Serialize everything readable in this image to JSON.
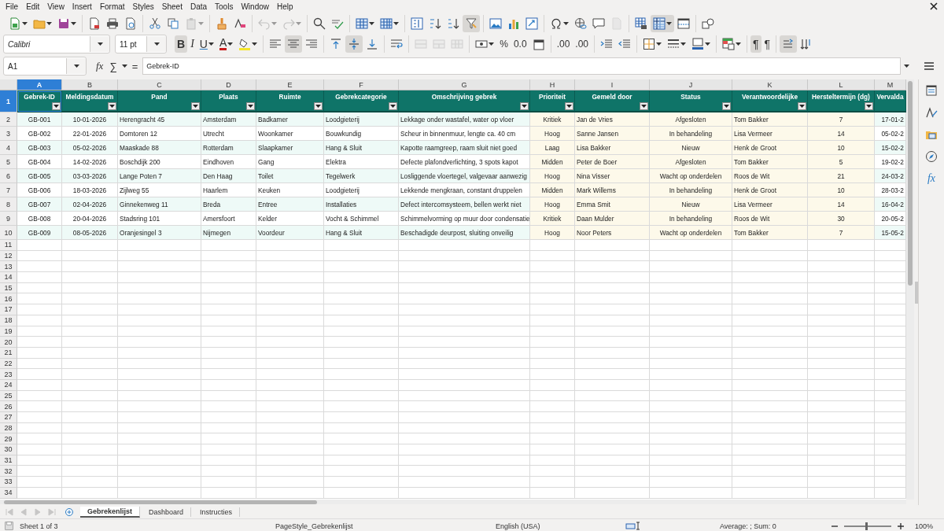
{
  "menu_bar": [
    "File",
    "Edit",
    "View",
    "Insert",
    "Format",
    "Styles",
    "Sheet",
    "Data",
    "Tools",
    "Window",
    "Help"
  ],
  "standard_toolbar": [
    [
      {
        "kind": "newsheet",
        "active": false,
        "disabled": false
      },
      {
        "kind": "open",
        "active": false,
        "disabled": false
      },
      {
        "kind": "save",
        "active": false,
        "disabled": false
      }
    ],
    [
      {
        "kind": "exportpdf",
        "active": false,
        "disabled": false
      },
      {
        "kind": "print",
        "active": false,
        "disabled": false
      },
      {
        "kind": "preview",
        "active": false,
        "disabled": false
      }
    ],
    [
      {
        "kind": "cut",
        "active": false,
        "disabled": false
      },
      {
        "kind": "copy",
        "active": false,
        "disabled": false
      },
      {
        "kind": "paste",
        "active": false,
        "disabled": true
      }
    ],
    [
      {
        "kind": "clone",
        "active": false,
        "disabled": false
      },
      {
        "kind": "clear",
        "active": false,
        "disabled": false
      }
    ],
    [
      {
        "kind": "undo",
        "active": false,
        "disabled": true
      },
      {
        "kind": "redo",
        "active": false,
        "disabled": true
      }
    ],
    [
      {
        "kind": "find",
        "active": false,
        "disabled": false
      },
      {
        "kind": "spelling",
        "active": false,
        "disabled": false
      }
    ],
    [
      {
        "kind": "row",
        "active": false,
        "disabled": false
      },
      {
        "kind": "column",
        "active": false,
        "disabled": false
      }
    ],
    [
      {
        "kind": "sort",
        "active": false,
        "disabled": false
      },
      {
        "kind": "sortasc",
        "active": false,
        "disabled": false
      },
      {
        "kind": "sortdesc",
        "active": false,
        "disabled": false
      },
      {
        "kind": "autofilter",
        "active": true,
        "disabled": false
      }
    ],
    [
      {
        "kind": "image",
        "active": false,
        "disabled": false
      },
      {
        "kind": "chart",
        "active": false,
        "disabled": false
      },
      {
        "kind": "pivot",
        "active": false,
        "disabled": false
      }
    ],
    [
      {
        "kind": "specialchar",
        "active": false,
        "disabled": false
      },
      {
        "kind": "hyperlink",
        "active": false,
        "disabled": false
      },
      {
        "kind": "comment",
        "active": false,
        "disabled": false
      },
      {
        "kind": "headerfooter",
        "active": false,
        "disabled": true
      }
    ],
    [
      {
        "kind": "printarea",
        "active": false,
        "disabled": false
      },
      {
        "kind": "freeze",
        "active": true,
        "disabled": false
      },
      {
        "kind": "split",
        "active": false,
        "disabled": false
      }
    ],
    [
      {
        "kind": "shapes",
        "active": false,
        "disabled": false
      }
    ]
  ],
  "font_name": "Calibri",
  "font_size": "11 pt",
  "formatting_toolbar": [
    [
      {
        "kind": "bold",
        "label": "B",
        "active": true,
        "disabled": false
      },
      {
        "kind": "italic",
        "label": "I",
        "active": false,
        "disabled": false
      },
      {
        "kind": "underline",
        "label": "U",
        "active": false,
        "disabled": false
      },
      {
        "kind": "fontcolor",
        "label": "A",
        "active": false,
        "disabled": false
      },
      {
        "kind": "highlight",
        "active": false,
        "disabled": false
      }
    ],
    [
      {
        "kind": "alignleft",
        "active": false,
        "disabled": false
      },
      {
        "kind": "aligncenter",
        "active": true,
        "disabled": false
      },
      {
        "kind": "alignright",
        "active": false,
        "disabled": false
      }
    ],
    [
      {
        "kind": "aligntop",
        "active": false,
        "disabled": false
      },
      {
        "kind": "alignmiddle",
        "active": true,
        "disabled": false
      },
      {
        "kind": "alignbottom",
        "active": false,
        "disabled": false
      }
    ],
    [
      {
        "kind": "wraptext",
        "active": false,
        "disabled": false
      }
    ],
    [
      {
        "kind": "merge",
        "active": false,
        "disabled": true
      },
      {
        "kind": "mergecells",
        "active": false,
        "disabled": true
      },
      {
        "kind": "unmerge",
        "active": false,
        "disabled": true
      }
    ],
    [
      {
        "kind": "currency",
        "active": false,
        "disabled": false
      },
      {
        "kind": "percent",
        "label": "%",
        "active": false,
        "disabled": false
      },
      {
        "kind": "number",
        "label": "0.0",
        "active": false,
        "disabled": false
      },
      {
        "kind": "date",
        "active": false,
        "disabled": false
      }
    ],
    [
      {
        "kind": "adddecimal",
        "label": ".00",
        "active": false,
        "disabled": false
      },
      {
        "kind": "deletedecimal",
        "label": ".00",
        "active": false,
        "disabled": false
      }
    ],
    [
      {
        "kind": "indent",
        "active": false,
        "disabled": false
      },
      {
        "kind": "outdent",
        "active": false,
        "disabled": false
      }
    ],
    [
      {
        "kind": "borders",
        "active": false,
        "disabled": false
      },
      {
        "kind": "borderstyle",
        "active": false,
        "disabled": false
      },
      {
        "kind": "bordercolor",
        "active": false,
        "disabled": false
      }
    ],
    [
      {
        "kind": "conditional",
        "active": false,
        "disabled": false
      }
    ],
    [
      {
        "kind": "ltr",
        "label": "¶",
        "active": true,
        "disabled": false
      },
      {
        "kind": "rtl",
        "label": "¶",
        "active": false,
        "disabled": false
      }
    ],
    [
      {
        "kind": "textdirection",
        "active": true,
        "disabled": false
      },
      {
        "kind": "stacked",
        "active": false,
        "disabled": false
      }
    ]
  ],
  "name_box": "A1",
  "function_wizard": "fx",
  "sum": "∑",
  "equals": "=",
  "formula": "Gebrek-ID",
  "column_headers": [
    {
      "label": "A",
      "selected": true
    },
    {
      "label": "B",
      "selected": false
    },
    {
      "label": "C",
      "selected": false
    },
    {
      "label": "D",
      "selected": false
    },
    {
      "label": "E",
      "selected": false
    },
    {
      "label": "F",
      "selected": false
    },
    {
      "label": "G",
      "selected": false
    },
    {
      "label": "H",
      "selected": false
    },
    {
      "label": "I",
      "selected": false
    },
    {
      "label": "J",
      "selected": false
    },
    {
      "label": "K",
      "selected": false
    },
    {
      "label": "L",
      "selected": false
    },
    {
      "label": "M",
      "selected": false
    }
  ],
  "header_row": {
    "number": "1",
    "selected": true,
    "cells": [
      "Gebrek-ID",
      "Meldingsdatum",
      "Pand",
      "Plaats",
      "Ruimte",
      "Gebrekcategorie",
      "Omschrijving gebrek",
      "Prioriteit",
      "Gemeld door",
      "Status",
      "Verantwoordelijke",
      "Hersteltermijn (dg)",
      "Vervalda"
    ]
  },
  "rows": [
    {
      "number": "2",
      "selected": false,
      "cells": [
        "GB-001",
        "10-01-2026",
        "Herengracht 45",
        "Amsterdam",
        "Badkamer",
        "Loodgieterij",
        "Lekkage onder wastafel, water op vloer",
        "Kritiek",
        "Jan de Vries",
        "Afgesloten",
        "Tom Bakker",
        "7",
        "17-01-2"
      ]
    },
    {
      "number": "3",
      "selected": false,
      "cells": [
        "GB-002",
        "22-01-2026",
        "Domtoren 12",
        "Utrecht",
        "Woonkamer",
        "Bouwkundig",
        "Scheur in binnenmuur, lengte ca. 40 cm",
        "Hoog",
        "Sanne Jansen",
        "In behandeling",
        "Lisa Vermeer",
        "14",
        "05-02-2"
      ]
    },
    {
      "number": "4",
      "selected": false,
      "cells": [
        "GB-003",
        "05-02-2026",
        "Maaskade 88",
        "Rotterdam",
        "Slaapkamer",
        "Hang & Sluit",
        "Kapotte raamgreep, raam sluit niet goed",
        "Laag",
        "Lisa Bakker",
        "Nieuw",
        "Henk de Groot",
        "10",
        "15-02-2"
      ]
    },
    {
      "number": "5",
      "selected": false,
      "cells": [
        "GB-004",
        "14-02-2026",
        "Boschdijk 200",
        "Eindhoven",
        "Gang",
        "Elektra",
        "Defecte plafondverlichting, 3 spots kapot",
        "Midden",
        "Peter de Boer",
        "Afgesloten",
        "Tom Bakker",
        "5",
        "19-02-2"
      ]
    },
    {
      "number": "6",
      "selected": false,
      "cells": [
        "GB-005",
        "03-03-2026",
        "Lange Poten 7",
        "Den Haag",
        "Toilet",
        "Tegelwerk",
        "Losliggende vloertegel, valgevaar aanwezig",
        "Hoog",
        "Nina Visser",
        "Wacht op onderdelen",
        "Roos de Wit",
        "21",
        "24-03-2"
      ]
    },
    {
      "number": "7",
      "selected": false,
      "cells": [
        "GB-006",
        "18-03-2026",
        "Zijlweg 55",
        "Haarlem",
        "Keuken",
        "Loodgieterij",
        "Lekkende mengkraan, constant druppelen",
        "Midden",
        "Mark Willems",
        "In behandeling",
        "Henk de Groot",
        "10",
        "28-03-2"
      ]
    },
    {
      "number": "8",
      "selected": false,
      "cells": [
        "GB-007",
        "02-04-2026",
        "Ginnekenweg 11",
        "Breda",
        "Entree",
        "Installaties",
        "Defect intercomsysteem, bellen werkt niet",
        "Hoog",
        "Emma Smit",
        "Nieuw",
        "Lisa Vermeer",
        "14",
        "16-04-2"
      ]
    },
    {
      "number": "9",
      "selected": false,
      "cells": [
        "GB-008",
        "20-04-2026",
        "Stadsring 101",
        "Amersfoort",
        "Kelder",
        "Vocht & Schimmel",
        "Schimmelvorming op muur door condensatie",
        "Kritiek",
        "Daan Mulder",
        "In behandeling",
        "Roos de Wit",
        "30",
        "20-05-2"
      ]
    },
    {
      "number": "10",
      "selected": false,
      "cells": [
        "GB-009",
        "08-05-2026",
        "Oranjesingel 3",
        "Nijmegen",
        "Voordeur",
        "Hang & Sluit",
        "Beschadigde deurpost, sluiting onveilig",
        "Hoog",
        "Noor Peters",
        "Wacht op onderdelen",
        "Tom Bakker",
        "7",
        "15-05-2"
      ]
    }
  ],
  "empty_rows": [
    "11",
    "12",
    "13",
    "14",
    "15",
    "16",
    "17",
    "18",
    "19",
    "20",
    "21",
    "22",
    "23",
    "24",
    "25",
    "26",
    "27",
    "28",
    "29",
    "30",
    "31",
    "32",
    "33",
    "34"
  ],
  "sidebar": [
    {
      "kind": "properties"
    },
    {
      "kind": "styles"
    },
    {
      "kind": "gallery"
    },
    {
      "kind": "navigator"
    },
    {
      "kind": "functions",
      "label": "fx"
    }
  ],
  "sheet_nav": [
    {
      "disabled": true
    },
    {
      "disabled": true
    },
    {
      "disabled": true
    },
    {
      "disabled": true
    }
  ],
  "sheet_tabs": [
    {
      "label": "Gebrekenlijst",
      "selected": true
    },
    {
      "label": "Dashboard",
      "selected": false
    },
    {
      "label": "Instructies",
      "selected": false
    }
  ],
  "status_bar": {
    "sheet": "Sheet 1 of 3",
    "page_style": "PageStyle_Gebrekenlijst",
    "language": "English (USA)",
    "summary": "Average: ; Sum: 0",
    "zoom": {
      "level": 0.45,
      "reading": "100%"
    }
  }
}
